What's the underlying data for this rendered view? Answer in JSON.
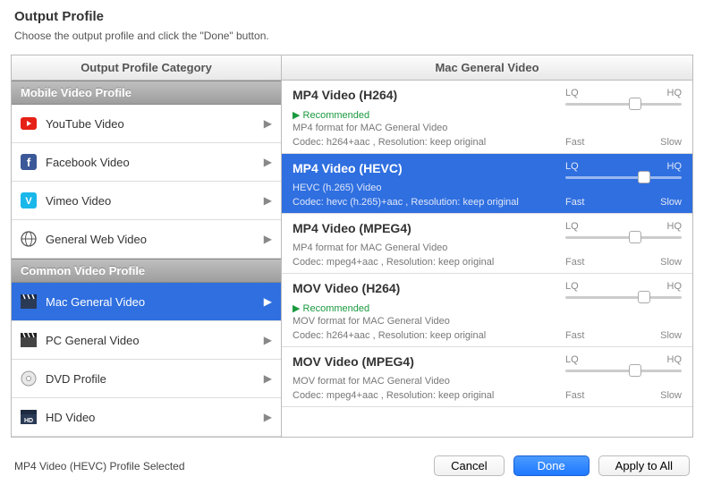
{
  "header": {
    "title": "Output Profile",
    "subtitle": "Choose the output profile and click the \"Done\" button."
  },
  "left": {
    "header": "Output Profile Category",
    "section_mobile": "Mobile Video Profile",
    "section_common": "Common Video Profile",
    "items_web": [
      {
        "label": "YouTube Video"
      },
      {
        "label": "Facebook Video"
      },
      {
        "label": "Vimeo Video"
      },
      {
        "label": "General Web Video"
      }
    ],
    "items_common": [
      {
        "label": "Mac General Video"
      },
      {
        "label": "PC General Video"
      },
      {
        "label": "DVD Profile"
      },
      {
        "label": "HD Video"
      }
    ]
  },
  "right": {
    "header": "Mac General Video",
    "quality_lq": "LQ",
    "quality_hq": "HQ",
    "speed_fast": "Fast",
    "speed_slow": "Slow",
    "recommended": "Recommended",
    "profiles": [
      {
        "title": "MP4 Video (H264)",
        "recommended": true,
        "desc": "MP4 format for MAC General Video",
        "codec": "Codec: h264+aac , Resolution: keep original",
        "thumb": 60
      },
      {
        "title": "MP4 Video (HEVC)",
        "recommended": false,
        "desc": "HEVC (h.265) Video",
        "codec": "Codec: hevc (h.265)+aac , Resolution: keep original",
        "thumb": 68
      },
      {
        "title": "MP4 Video (MPEG4)",
        "recommended": false,
        "desc": "MP4 format for MAC General Video",
        "codec": "Codec: mpeg4+aac , Resolution: keep original",
        "thumb": 60
      },
      {
        "title": "MOV Video (H264)",
        "recommended": true,
        "desc": "MOV format for MAC General Video",
        "codec": "Codec: h264+aac , Resolution: keep original",
        "thumb": 68
      },
      {
        "title": "MOV Video (MPEG4)",
        "recommended": false,
        "desc": "MOV format for MAC General Video",
        "codec": "Codec: mpeg4+aac , Resolution: keep original",
        "thumb": 60
      }
    ],
    "selected_index": 1
  },
  "footer": {
    "status": "MP4 Video (HEVC) Profile Selected",
    "cancel": "Cancel",
    "done": "Done",
    "apply": "Apply to All"
  }
}
